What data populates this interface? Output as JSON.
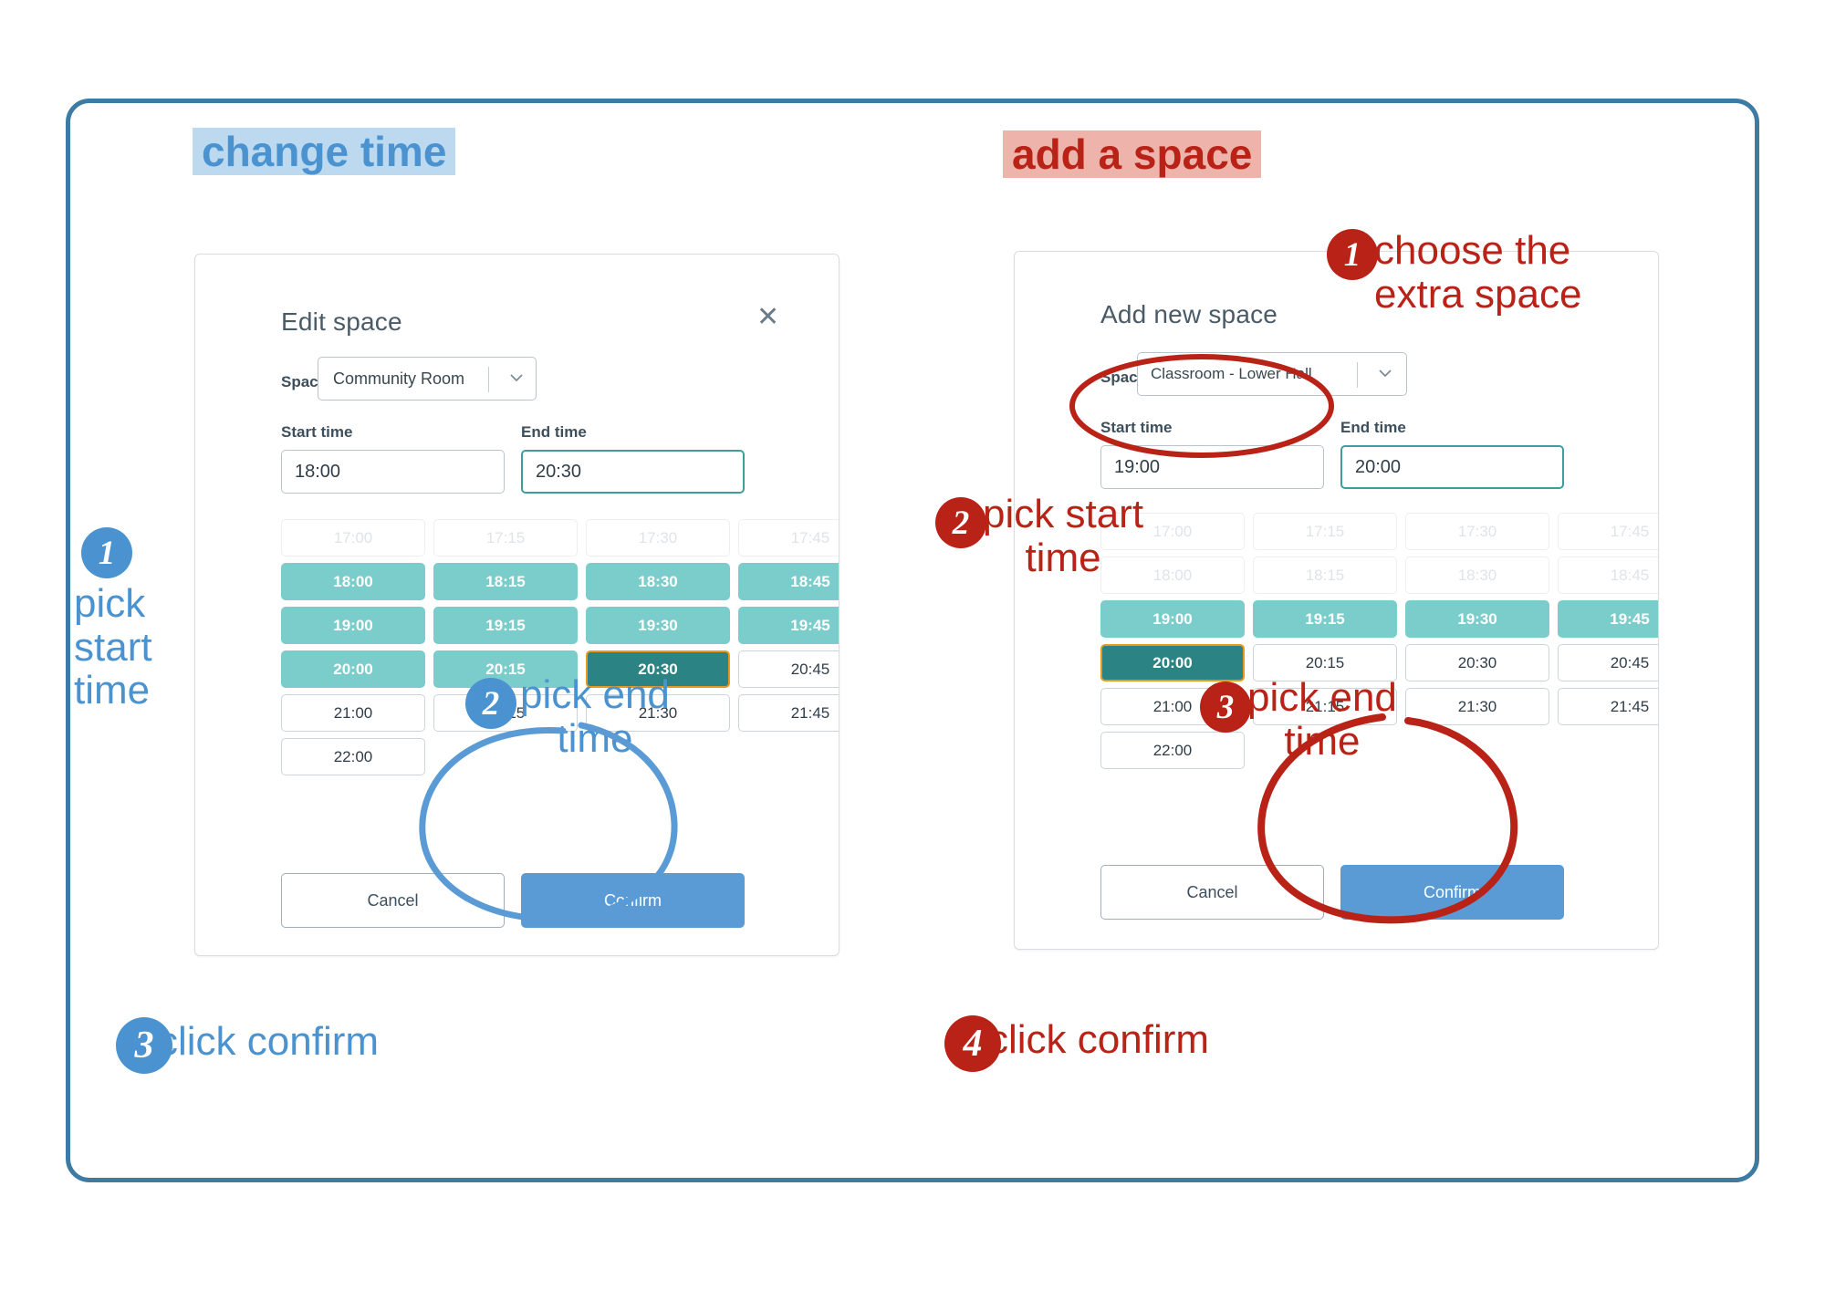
{
  "headings": {
    "left": "change time",
    "right": "add a space"
  },
  "left_dialog": {
    "title": "Edit space",
    "close_icon": "close-icon",
    "space_label": "Space",
    "space_value": "Community Room",
    "chevron_icon": "chevron-down-icon",
    "start_label": "Start time",
    "start_value": "18:00",
    "end_label": "End time",
    "end_value": "20:30",
    "slots": [
      {
        "t": "17:00",
        "state": "disabled"
      },
      {
        "t": "17:15",
        "state": "disabled"
      },
      {
        "t": "17:30",
        "state": "disabled"
      },
      {
        "t": "17:45",
        "state": "disabled"
      },
      {
        "t": "18:00",
        "state": "sel"
      },
      {
        "t": "18:15",
        "state": "sel"
      },
      {
        "t": "18:30",
        "state": "sel"
      },
      {
        "t": "18:45",
        "state": "sel"
      },
      {
        "t": "19:00",
        "state": "sel"
      },
      {
        "t": "19:15",
        "state": "sel"
      },
      {
        "t": "19:30",
        "state": "sel"
      },
      {
        "t": "19:45",
        "state": "sel"
      },
      {
        "t": "20:00",
        "state": "sel"
      },
      {
        "t": "20:15",
        "state": "sel"
      },
      {
        "t": "20:30",
        "state": "edge"
      },
      {
        "t": "20:45",
        "state": "avail"
      },
      {
        "t": "21:00",
        "state": "avail"
      },
      {
        "t": "21:15",
        "state": "avail"
      },
      {
        "t": "21:30",
        "state": "avail"
      },
      {
        "t": "21:45",
        "state": "avail"
      },
      {
        "t": "22:00",
        "state": "avail"
      },
      {
        "t": "",
        "state": "empty"
      },
      {
        "t": "",
        "state": "empty"
      },
      {
        "t": "",
        "state": "empty"
      }
    ],
    "cancel_label": "Cancel",
    "confirm_label": "Confirm"
  },
  "right_dialog": {
    "title": "Add new space",
    "space_label": "Space",
    "space_value": "Classroom - Lower Hall",
    "chevron_icon": "chevron-down-icon",
    "start_label": "Start time",
    "start_value": "19:00",
    "end_label": "End time",
    "end_value": "20:00",
    "slots": [
      {
        "t": "17:00",
        "state": "disabled"
      },
      {
        "t": "17:15",
        "state": "disabled"
      },
      {
        "t": "17:30",
        "state": "disabled"
      },
      {
        "t": "17:45",
        "state": "disabled"
      },
      {
        "t": "18:00",
        "state": "disabled"
      },
      {
        "t": "18:15",
        "state": "disabled"
      },
      {
        "t": "18:30",
        "state": "disabled"
      },
      {
        "t": "18:45",
        "state": "disabled"
      },
      {
        "t": "19:00",
        "state": "sel"
      },
      {
        "t": "19:15",
        "state": "sel"
      },
      {
        "t": "19:30",
        "state": "sel"
      },
      {
        "t": "19:45",
        "state": "sel"
      },
      {
        "t": "20:00",
        "state": "edge"
      },
      {
        "t": "20:15",
        "state": "avail"
      },
      {
        "t": "20:30",
        "state": "avail"
      },
      {
        "t": "20:45",
        "state": "avail"
      },
      {
        "t": "21:00",
        "state": "avail"
      },
      {
        "t": "21:15",
        "state": "avail"
      },
      {
        "t": "21:30",
        "state": "avail"
      },
      {
        "t": "21:45",
        "state": "avail"
      },
      {
        "t": "22:00",
        "state": "avail"
      },
      {
        "t": "",
        "state": "empty"
      },
      {
        "t": "",
        "state": "empty"
      },
      {
        "t": "",
        "state": "empty"
      }
    ],
    "cancel_label": "Cancel",
    "confirm_label": "Confirm"
  },
  "annotations": {
    "left": [
      {
        "num": "1",
        "line1": "pick",
        "line2": "start",
        "line3": "time"
      },
      {
        "num": "2",
        "line1": "pick end",
        "line2": "time"
      },
      {
        "num": "3",
        "line1": "click confirm"
      }
    ],
    "right": [
      {
        "num": "1",
        "line1": "choose the",
        "line2": "extra space"
      },
      {
        "num": "2",
        "line1": "pick start",
        "line2": "time"
      },
      {
        "num": "3",
        "line1": "pick end",
        "line2": "time"
      },
      {
        "num": "4",
        "line1": "click confirm"
      }
    ]
  },
  "colors": {
    "frame_border": "#3d7ba3",
    "accent_blue": "#4a93d0",
    "accent_red": "#b92216",
    "slot_selected": "#7bcdcb",
    "slot_edge": "#2c8383",
    "slot_edge_border": "#e8991f",
    "confirm_button": "#5b9bd5",
    "highlight_blue_bg": "#bcd9ef",
    "highlight_red_bg": "#eeb3ab"
  }
}
